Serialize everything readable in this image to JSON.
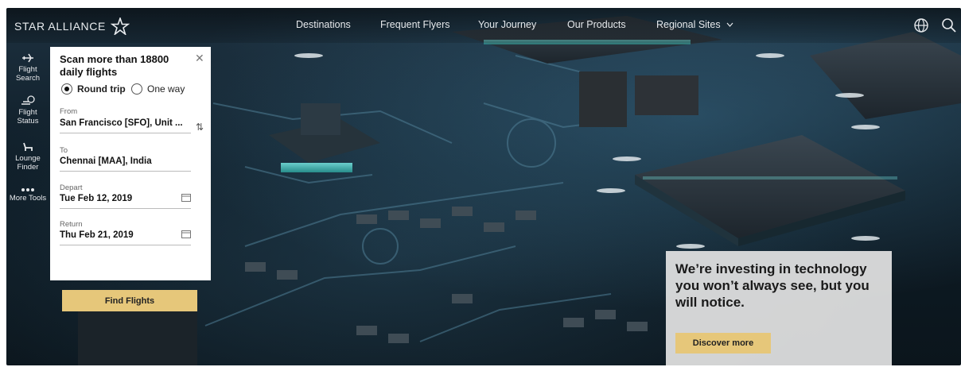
{
  "brand": {
    "name": "STAR ALLIANCE",
    "logo_icon": "star-alliance-logo-icon"
  },
  "nav": {
    "items": [
      {
        "label": "Destinations"
      },
      {
        "label": "Frequent Flyers"
      },
      {
        "label": "Your Journey"
      },
      {
        "label": "Our Products"
      },
      {
        "label": "Regional Sites",
        "icon": "chevron-down-icon"
      }
    ],
    "globe_icon": "globe-icon",
    "search_icon": "search-icon"
  },
  "tools": [
    {
      "label_line1": "Flight",
      "label_line2": "Search",
      "icon": "airplane-icon"
    },
    {
      "label_line1": "Flight",
      "label_line2": "Status",
      "icon": "flight-status-icon"
    },
    {
      "label_line1": "Lounge",
      "label_line2": "Finder",
      "icon": "lounge-chair-icon"
    },
    {
      "label_line1": "More Tools",
      "label_line2": "",
      "icon": "more-dots-icon"
    }
  ],
  "booking": {
    "title": "Scan more than 18800 daily flights",
    "trip_options": [
      "Round trip",
      "One way"
    ],
    "selected_trip": "Round trip",
    "from_label": "From",
    "from_value": "San Francisco [SFO], Unit ...",
    "to_label": "To",
    "to_value": "Chennai [MAA], India",
    "depart_label": "Depart",
    "depart_value": "Tue Feb 12, 2019",
    "return_label": "Return",
    "return_value": "Thu Feb 21, 2019",
    "find_label": "Find Flights"
  },
  "promo": {
    "headline": "We’re investing in technology you won’t always see, but you will notice.",
    "button_label": "Discover more"
  },
  "colors": {
    "accent": "#e6c77a",
    "nav_text": "#e6e9ec",
    "panel_bg": "#ffffff"
  }
}
